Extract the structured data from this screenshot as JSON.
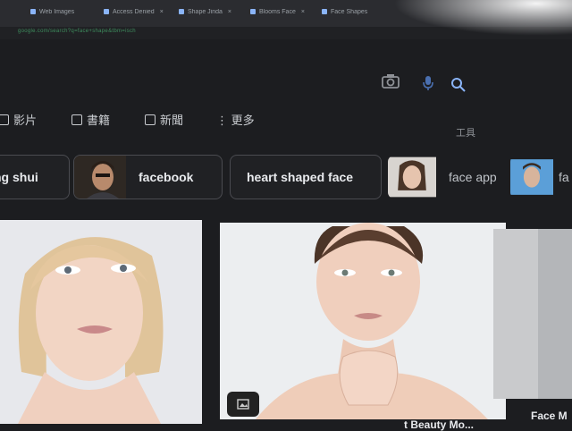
{
  "browser": {
    "tabs": [
      {
        "label": "Web Images"
      },
      {
        "label": "Access Denied"
      },
      {
        "label": "Shape Jinda"
      },
      {
        "label": "Blooms Face"
      },
      {
        "label": "Face Shapes"
      }
    ],
    "url_text": "google.com/search?q=face+shape&tbm=isch"
  },
  "search": {
    "camera_icon": "camera-icon",
    "mic_icon": "mic-icon",
    "search_icon": "search-icon"
  },
  "tools": {
    "videos": "影片",
    "books": "書籍",
    "news": "新聞",
    "more": "更多",
    "tools_label": "工具"
  },
  "chips": [
    {
      "label": "ng shui"
    },
    {
      "label": "facebook"
    },
    {
      "label": "heart shaped face"
    },
    {
      "label": "face app"
    },
    {
      "label": "fa"
    }
  ],
  "results": [
    {
      "caption": "t Beauty Mo..."
    },
    {
      "caption": "Face M"
    }
  ],
  "colors": {
    "background": "#1c1d20",
    "chip_border": "#4a4b50",
    "text": "#e8eaed"
  }
}
